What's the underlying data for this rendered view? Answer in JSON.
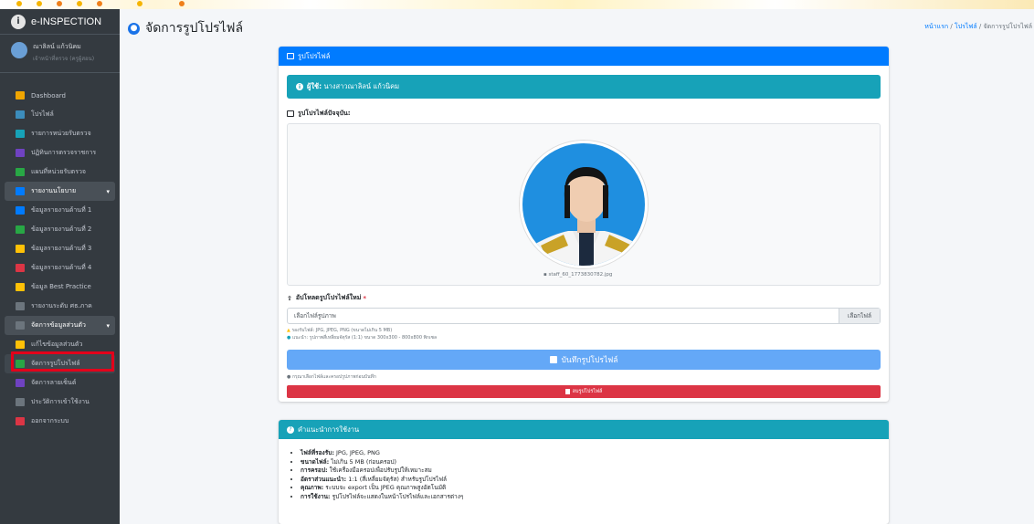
{
  "app": {
    "brand": "e-INSPECTION"
  },
  "user": {
    "name": "ณาลิลน์ แก้วนิคม",
    "role": "เจ้าหน้าที่ตรวจ (ครูผู้สอน)"
  },
  "sidebar": {
    "items": [
      {
        "label": "Dashboard",
        "icon": "gauge-icon",
        "color": "#f0a500"
      },
      {
        "label": "โปรไฟล์",
        "icon": "user-icon",
        "color": "#3c8dbc"
      },
      {
        "label": "รายการหน่วยรับตรวจ",
        "icon": "list-icon",
        "color": "#17a2b8"
      },
      {
        "label": "ปฏิทินการตรวจราชการ",
        "icon": "calendar-icon",
        "color": "#6f42c1"
      },
      {
        "label": "แผนที่หน่วยรับตรวจ",
        "icon": "map-icon",
        "color": "#28a745"
      },
      {
        "label": "รายงานนโยบาย",
        "icon": "folder-icon",
        "color": "#007bff",
        "group": true
      },
      {
        "label": "ข้อมูลรายงานด้านที่ 1",
        "icon": "file-icon",
        "color": "#007bff"
      },
      {
        "label": "ข้อมูลรายงานด้านที่ 2",
        "icon": "file-icon",
        "color": "#28a745"
      },
      {
        "label": "ข้อมูลรายงานด้านที่ 3",
        "icon": "file-icon",
        "color": "#ffc107"
      },
      {
        "label": "ข้อมูลรายงานด้านที่ 4",
        "icon": "file-icon",
        "color": "#dc3545"
      },
      {
        "label": "ข้อมูล Best Practice",
        "icon": "trophy-icon",
        "color": "#ffc107"
      },
      {
        "label": "รายงานระดับ ศธ.ภาค",
        "icon": "chart-icon",
        "color": "#6c757d"
      },
      {
        "label": "จัดการข้อมูลส่วนตัว",
        "icon": "cogs-icon",
        "color": "#6c757d",
        "group": true
      },
      {
        "label": "แก้ไขข้อมูลส่วนตัว",
        "icon": "user-edit-icon",
        "color": "#ffc107"
      },
      {
        "label": "จัดการรูปโปรไฟล์",
        "icon": "image-icon",
        "color": "#28a745",
        "active": true
      },
      {
        "label": "จัดการลายเซ็นต์",
        "icon": "signature-icon",
        "color": "#6f42c1"
      },
      {
        "label": "ประวัติการเข้าใช้งาน",
        "icon": "history-icon",
        "color": "#6c757d"
      },
      {
        "label": "ออกจากระบบ",
        "icon": "logout-icon",
        "color": "#dc3545"
      }
    ]
  },
  "header": {
    "title": "จัดการรูปโปรไฟล์",
    "breadcrumb": {
      "home": "หน้าแรก",
      "sep": " / ",
      "profile": "โปรไฟล์",
      "current": "จัดการรูปโปรไฟล์"
    }
  },
  "profile_card": {
    "header": "รูปโปรไฟล์",
    "user_label": "ผู้ใช้:",
    "user_value": "นางสาวณาลิลน์ แก้วนิคม",
    "current_label": "รูปโปรไฟล์ปัจจุบัน:",
    "filename": "staff_60_1773830782.jpg",
    "upload_label": "อัปโหลดรูปโปรไฟล์ใหม่",
    "upload_required": "*",
    "file_placeholder": "เลือกไฟล์รูปภาพ",
    "file_button": "เลือกไฟล์",
    "hint1": "รองรับไฟล์: JPG, JPEG, PNG (ขนาดไม่เกิน 5 MB)",
    "hint2": "แนะนำ: รูปภาพสี่เหลี่ยมจัตุรัส (1:1) ขนาด 300x300 - 800x800 พิกเซล",
    "save_button": "บันทึกรูปโปรไฟล์",
    "note": "กรุณาเลือกไฟล์และครอปรูปภาพก่อนบันทึก",
    "delete_button": "ลบรูปโปรไฟล์"
  },
  "guide_card": {
    "header": "คำแนะนำการใช้งาน",
    "items": [
      {
        "k": "ไฟล์ที่รองรับ:",
        "v": " JPG, JPEG, PNG"
      },
      {
        "k": "ขนาดไฟล์:",
        "v": " ไม่เกิน 5 MB (ก่อนครอป)"
      },
      {
        "k": "การครอป:",
        "v": " ใช้เครื่องมือครอปเพื่อปรับรูปให้เหมาะสม"
      },
      {
        "k": "อัตราส่วนแนะนำ:",
        "v": " 1:1 (สี่เหลี่ยมจัตุรัส) สำหรับรูปโปรไฟล์"
      },
      {
        "k": "คุณภาพ:",
        "v": " ระบบจะ export เป็น JPEG คุณภาพสูงอัตโนมัติ"
      },
      {
        "k": "การใช้งาน:",
        "v": " รูปโปรไฟล์จะแสดงในหน้าโปรไฟล์และเอกสารต่างๆ"
      }
    ]
  }
}
